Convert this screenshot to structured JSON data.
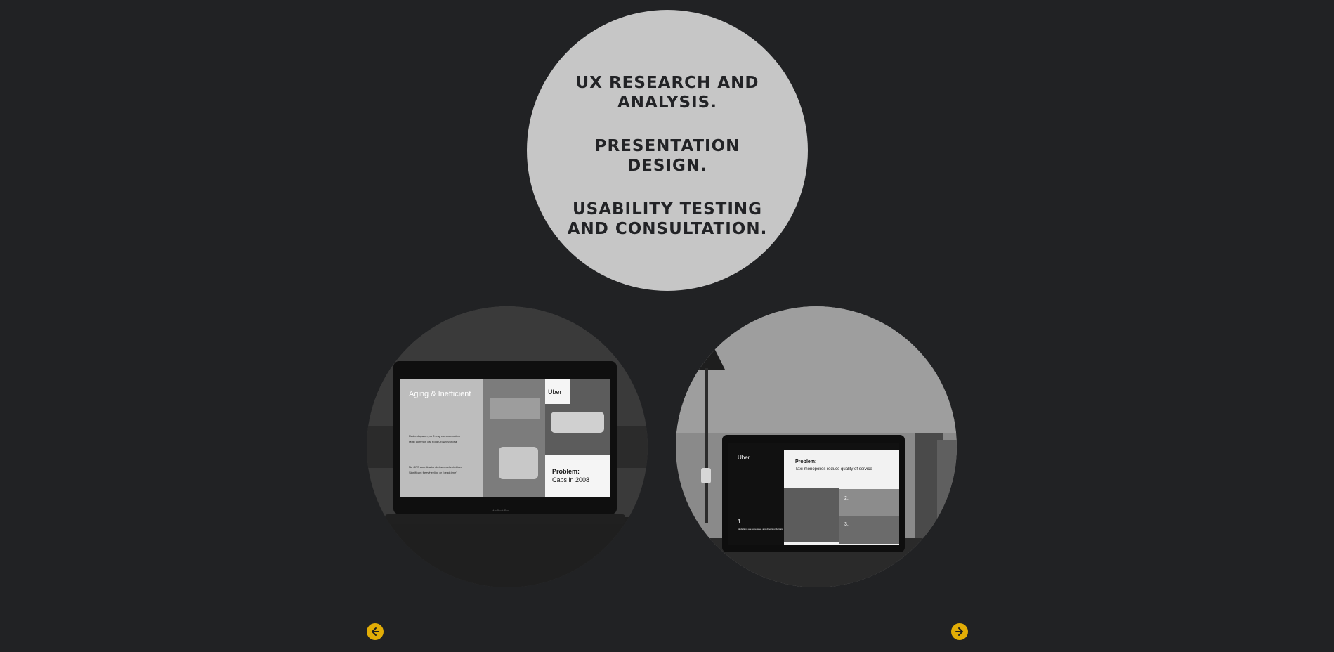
{
  "services": [
    "UX RESEARCH AND ANALYSIS.",
    "PRESENTATION DESIGN.",
    "USABILITY TESTING AND CONSULTATION."
  ],
  "gallery": {
    "left_slide": {
      "heading": "Aging & Inefficient",
      "brand": "Uber",
      "problem_title": "Problem:",
      "problem_text": "Cabs in 2008",
      "bullets": [
        "Radio dispatch, no 2-way communication",
        "Most common car Ford Crown Victoria",
        "No GPS coordination between client/driver",
        "Significant freewheeling or \"dead-time\""
      ],
      "laptop_brand": "MacBook Pro"
    },
    "right_slide": {
      "brand": "Uber",
      "problem_title": "Problem:",
      "problem_text": "Taxi-monopolies reduce quality of service",
      "step1": "1.",
      "step1_text": "Medallions are expensive, and drivers underpaid",
      "step2": "2.",
      "step3": "3."
    }
  },
  "nav": {
    "prev_icon": "arrow-left-icon",
    "next_icon": "arrow-right-icon"
  },
  "colors": {
    "background": "#212224",
    "circle": "#c6c6c6",
    "accent": "#e2ad06"
  }
}
